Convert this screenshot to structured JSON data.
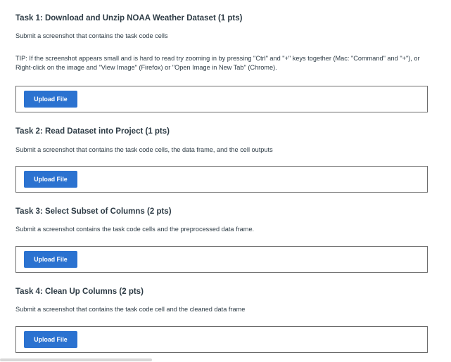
{
  "tasks": [
    {
      "title": "Task 1: Download and Unzip NOAA Weather Dataset (1 pts)",
      "description": "Submit a screenshot that contains the task code cells",
      "tip": "TIP: If the screenshot appears small and is hard to read try zooming in by pressing \"Ctrl\" and \"+\" keys together (Mac: \"Command\" and \"+\"), or Right-click on the image and \"View Image\" (Firefox) or \"Open Image in New Tab\" (Chrome).",
      "upload_label": "Upload File"
    },
    {
      "title": "Task 2: Read Dataset into Project (1 pts)",
      "description": "Submit a screenshot that contains the task code cells, the data frame, and the cell outputs",
      "upload_label": "Upload File"
    },
    {
      "title": "Task 3: Select Subset of Columns (2 pts)",
      "description": "Submit a screenshot contains the task code cells and the preprocessed data frame.",
      "upload_label": "Upload File"
    },
    {
      "title": "Task 4: Clean Up Columns (2 pts)",
      "description": "Submit a screenshot that contains the task code cell and the cleaned data frame",
      "upload_label": "Upload File"
    }
  ],
  "colors": {
    "upload_button": "#2b72d0",
    "text": "#2d3b45",
    "box_border": "#6b6b6b"
  }
}
